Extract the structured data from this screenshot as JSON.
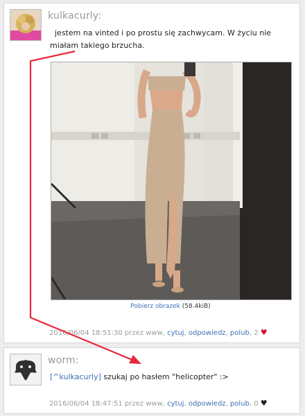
{
  "posts": [
    {
      "username": "kulkacurly:",
      "text": "jestem na vinted i po prostu się zachwycam. W życiu nie miałam takiego brzucha.",
      "image_link": "Pobierz obrazek",
      "image_size": "(58.4kiB)",
      "timestamp": "2016/06/04 18:51:30 przez www,",
      "actions": {
        "quote": "cytuj",
        "reply": "odpowiedz",
        "like": "polub"
      },
      "likes": "2",
      "heart": "♥",
      "heart_color": "#d0112b"
    },
    {
      "username": "worm:",
      "mention": "[^kulkacurly]",
      "text": "szukaj po hasłem \"helicopter\" :>",
      "timestamp": "2016/06/04 18:47:51 przez www,",
      "actions": {
        "quote": "cytuj",
        "reply": "odpowiedz",
        "like": "polub"
      },
      "likes": "0",
      "heart": "♥",
      "heart_color": "#222222"
    }
  ],
  "annotation": {
    "color": "#e8293a"
  }
}
